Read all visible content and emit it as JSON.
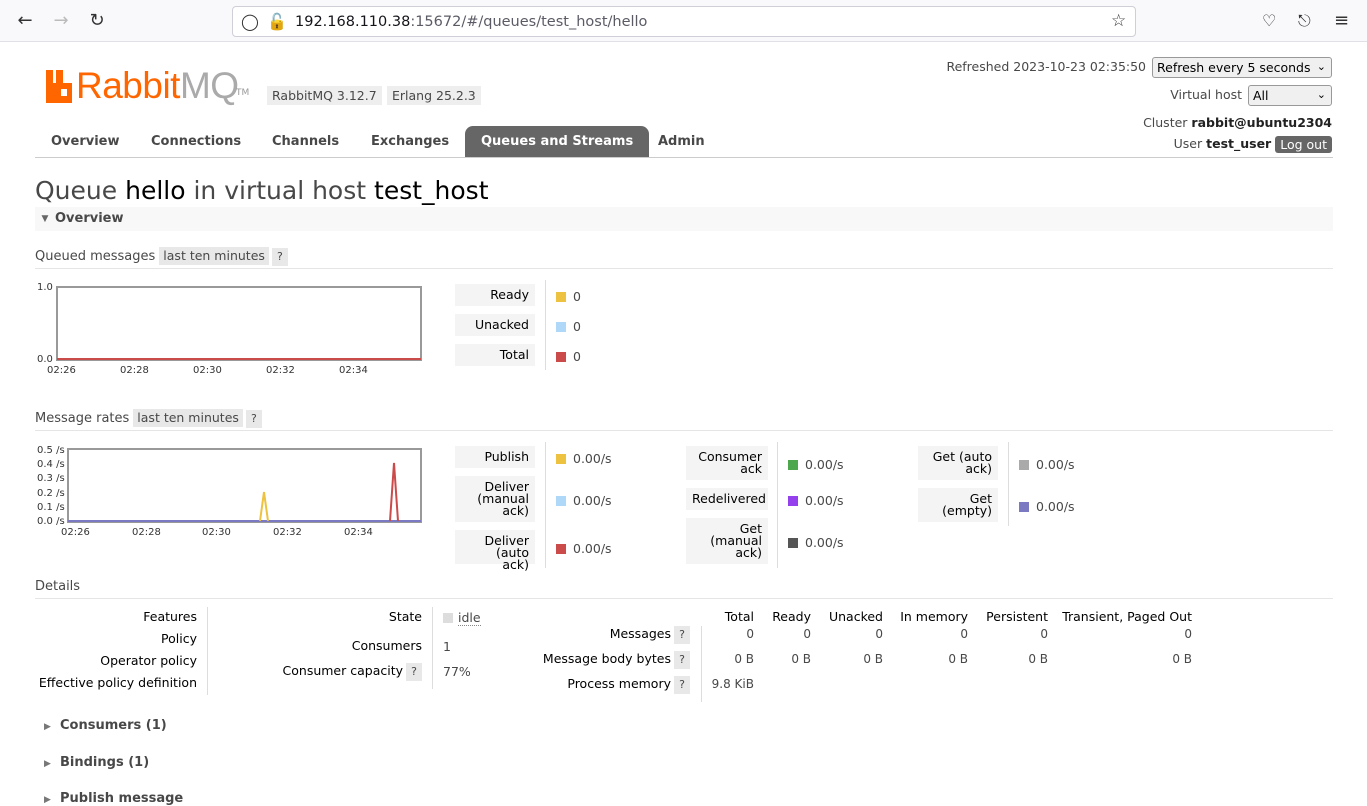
{
  "browser": {
    "url_host": "192.168.110.38",
    "url_rest": ":15672/#/queues/test_host/hello"
  },
  "header": {
    "logo_rabbit": "Rabbit",
    "logo_mq": "MQ",
    "logo_tm": "TM",
    "rabbitmq_version": "RabbitMQ 3.12.7",
    "erlang_version": "Erlang 25.2.3",
    "refreshed_label": "Refreshed 2023-10-23 02:35:50",
    "refresh_select": "Refresh every 5 seconds",
    "vhost_label": "Virtual host",
    "vhost_select": "All",
    "cluster_label": "Cluster",
    "cluster_name": "rabbit@ubuntu2304",
    "user_label": "User",
    "user_name": "test_user",
    "logout": "Log out"
  },
  "tabs": [
    "Overview",
    "Connections",
    "Channels",
    "Exchanges",
    "Queues and Streams",
    "Admin"
  ],
  "title": {
    "prefix": "Queue",
    "queue": "hello",
    "middle": "in virtual host",
    "vhost": "test_host"
  },
  "overview": {
    "heading": "Overview",
    "queued_heading": "Queued messages",
    "queued_range": "last ten minutes",
    "help": "?",
    "queued_chart": {
      "y_ticks": [
        "1.0",
        "0.0"
      ],
      "x_ticks": [
        "02:26",
        "02:28",
        "02:30",
        "02:32",
        "02:34"
      ]
    },
    "queued_legend": [
      {
        "label": "Ready",
        "value": "0",
        "color": "#edc240"
      },
      {
        "label": "Unacked",
        "value": "0",
        "color": "#afd8f8"
      },
      {
        "label": "Total",
        "value": "0",
        "color": "#cb4b4b"
      }
    ],
    "rates_heading": "Message rates",
    "rates_range": "last ten minutes",
    "rates_chart": {
      "y_ticks": [
        "0.5 /s",
        "0.4 /s",
        "0.3 /s",
        "0.2 /s",
        "0.1 /s",
        "0.0 /s"
      ],
      "x_ticks": [
        "02:26",
        "02:28",
        "02:30",
        "02:32",
        "02:34"
      ]
    },
    "rates_col1": [
      {
        "label": "Publish",
        "value": "0.00/s",
        "color": "#edc240"
      },
      {
        "label": "Deliver (manual ack)",
        "value": "0.00/s",
        "color": "#afd8f8"
      },
      {
        "label": "Deliver (auto ack)",
        "value": "0.00/s",
        "color": "#cb4b4b"
      }
    ],
    "rates_col2": [
      {
        "label": "Consumer ack",
        "value": "0.00/s",
        "color": "#4da74d"
      },
      {
        "label": "Redelivered",
        "value": "0.00/s",
        "color": "#9440ed"
      },
      {
        "label": "Get (manual ack)",
        "value": "0.00/s",
        "color": "#555555"
      }
    ],
    "rates_col3": [
      {
        "label": "Get (auto ack)",
        "value": "0.00/s",
        "color": "#aaaaaa"
      },
      {
        "label": "Get (empty)",
        "value": "0.00/s",
        "color": "#7c79c3"
      }
    ]
  },
  "details": {
    "heading": "Details",
    "policy_labels": [
      "Features",
      "Policy",
      "Operator policy",
      "Effective policy definition"
    ],
    "state_label": "State",
    "state_value": "idle",
    "consumers_label": "Consumers",
    "consumers_value": "1",
    "capacity_label": "Consumer capacity",
    "capacity_value": "77%",
    "table_headers": [
      "Total",
      "Ready",
      "Unacked",
      "In memory",
      "Persistent",
      "Transient, Paged Out"
    ],
    "messages_label": "Messages",
    "messages_values": [
      "0",
      "0",
      "0",
      "0",
      "0",
      "0"
    ],
    "body_bytes_label": "Message body bytes",
    "body_bytes_values": [
      "0 B",
      "0 B",
      "0 B",
      "0 B",
      "0 B",
      "0 B"
    ],
    "process_memory_label": "Process memory",
    "process_memory_value": "9.8 KiB"
  },
  "collapsed_sections": [
    "Consumers (1)",
    "Bindings (1)",
    "Publish message"
  ]
}
